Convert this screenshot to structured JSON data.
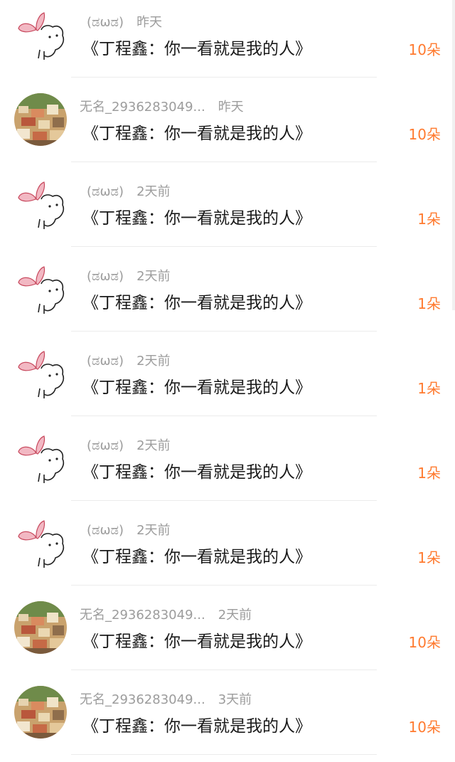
{
  "comments": [
    {
      "avatar": "butterfly-bear",
      "name": "(ಡωಡ)",
      "time": "昨天",
      "text": "《丁程鑫：你一看就是我的人》",
      "amount": "10朵"
    },
    {
      "avatar": "town-photo",
      "name": "无名_2936283049...",
      "time": "昨天",
      "text": "《丁程鑫：你一看就是我的人》",
      "amount": "10朵"
    },
    {
      "avatar": "butterfly-bear",
      "name": "(ಡωಡ)",
      "time": "2天前",
      "text": "《丁程鑫：你一看就是我的人》",
      "amount": "1朵"
    },
    {
      "avatar": "butterfly-bear",
      "name": "(ಡωಡ)",
      "time": "2天前",
      "text": "《丁程鑫：你一看就是我的人》",
      "amount": "1朵"
    },
    {
      "avatar": "butterfly-bear",
      "name": "(ಡωಡ)",
      "time": "2天前",
      "text": "《丁程鑫：你一看就是我的人》",
      "amount": "1朵"
    },
    {
      "avatar": "butterfly-bear",
      "name": "(ಡωಡ)",
      "time": "2天前",
      "text": "《丁程鑫：你一看就是我的人》",
      "amount": "1朵"
    },
    {
      "avatar": "butterfly-bear",
      "name": "(ಡωಡ)",
      "time": "2天前",
      "text": "《丁程鑫：你一看就是我的人》",
      "amount": "1朵"
    },
    {
      "avatar": "town-photo",
      "name": "无名_2936283049...",
      "time": "2天前",
      "text": "《丁程鑫：你一看就是我的人》",
      "amount": "10朵"
    },
    {
      "avatar": "town-photo",
      "name": "无名_2936283049...",
      "time": "3天前",
      "text": "《丁程鑫：你一看就是我的人》",
      "amount": "10朵"
    }
  ],
  "colors": {
    "amount": "#ff7a2f",
    "meta": "#9c9c9c",
    "text": "#1a1a1a",
    "divider": "#ececec"
  }
}
